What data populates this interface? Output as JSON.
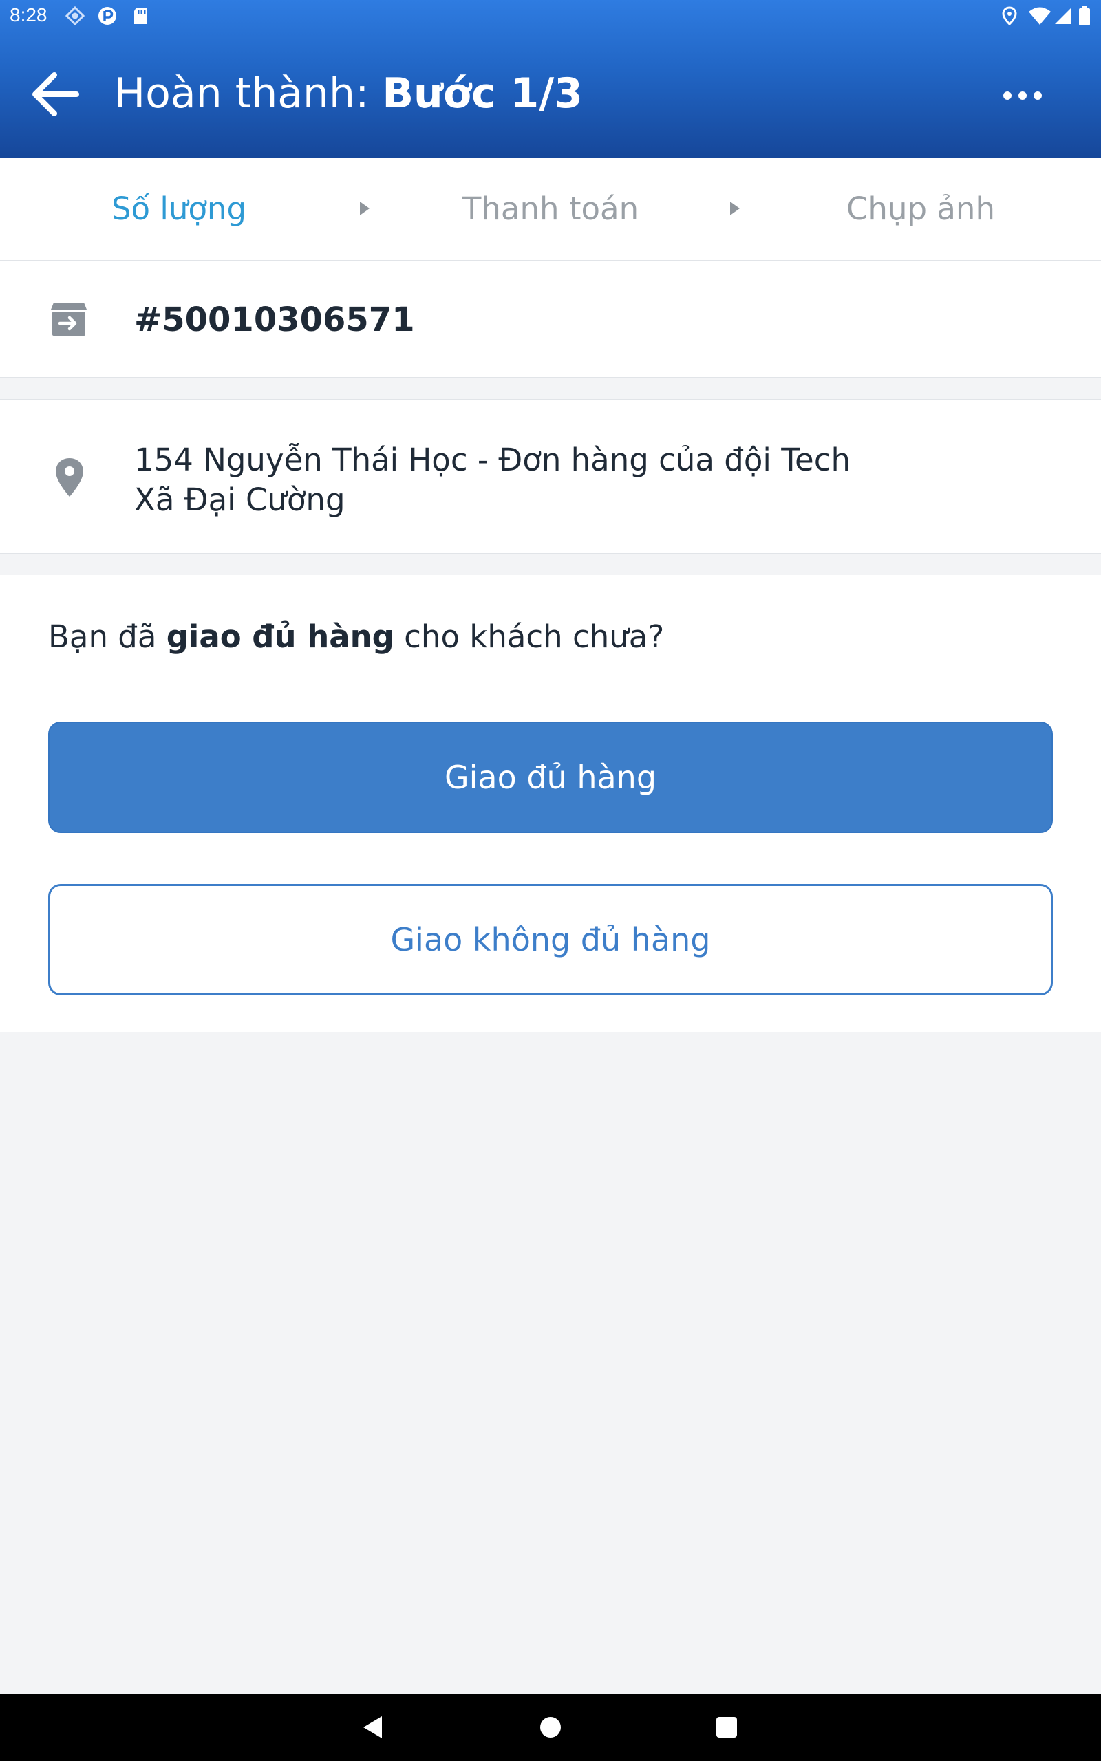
{
  "status_bar": {
    "time": "8:28",
    "left_icons": [
      "navigation-icon",
      "pocket-icon",
      "sd-card-icon"
    ],
    "right_icons": [
      "location-icon",
      "wifi-icon",
      "signal-icon",
      "battery-icon"
    ]
  },
  "toolbar": {
    "title_prefix": "Hoàn thành:",
    "title_step": "Bước 1/3",
    "back_icon": "arrow-left-icon",
    "menu_icon": "more-horizontal-icon"
  },
  "stepper": {
    "steps": [
      {
        "label": "Số lượng",
        "state": "active"
      },
      {
        "label": "Thanh toán",
        "state": "inactive"
      },
      {
        "label": "Chụp ảnh",
        "state": "inactive"
      }
    ],
    "active_color": "#2e9ad4",
    "inactive_color": "#9aa0a6"
  },
  "order": {
    "icon": "archive-arrow-icon",
    "id": "#50010306571"
  },
  "address": {
    "icon": "map-pin-icon",
    "line1": "154 Nguyễn Thái Học - Đơn hàng của đội Tech",
    "line2": "Xã Đại Cường"
  },
  "question": {
    "before": "Bạn đã ",
    "emphasis": "giao đủ hàng",
    "after": " cho khách chưa?"
  },
  "actions": {
    "primary_label": "Giao đủ hàng",
    "secondary_label": "Giao không đủ hàng",
    "accent_color": "#3d7ec9"
  },
  "nav_bar": {
    "icons": [
      "back-triangle-icon",
      "home-circle-icon",
      "recents-square-icon"
    ]
  }
}
